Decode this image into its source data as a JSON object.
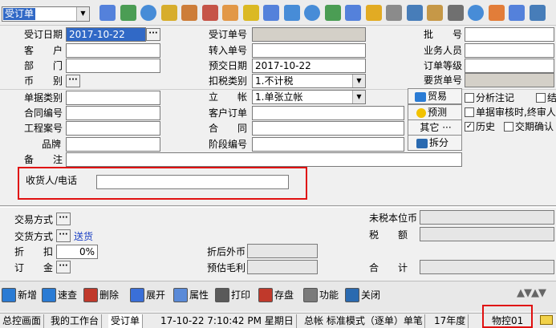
{
  "window_select": "受订单",
  "toolbar_icons": [
    "barcode-icon",
    "monitor-icon",
    "globe-icon",
    "lock-icon",
    "briefcase-icon",
    "house-icon",
    "users-icon",
    "mail-icon",
    "book-icon",
    "key-icon",
    "help-icon",
    "dollar-icon",
    "cart-icon",
    "finance-icon",
    "copy-icon",
    "calc-icon",
    "db-icon",
    "print-icon",
    "check-icon",
    "flag-icon",
    "search-doc-icon",
    "zoom-icon"
  ],
  "form": {
    "order_date_label": "受订日期",
    "order_date": "2017-10-22",
    "customer_label": "客　　户",
    "department_label": "部　　门",
    "currency_label": "币　　别",
    "doc_type_label": "单据类别",
    "contract_no_label": "合同编号",
    "project_no_label": "工程案号",
    "brand_label": "品牌",
    "remark_label": "备　　注",
    "order_no_label": "受订单号",
    "import_no_label": "转入单号",
    "delivery_date_label": "预交日期",
    "delivery_date": "2017-10-22",
    "tax_type_label": "扣税类别",
    "tax_type": "1.不计税",
    "account_label": "立　　帐",
    "account": "1.单张立帐",
    "cust_order_label": "客户订单",
    "contract_label": "合　　同",
    "stage_no_label": "阶段编号",
    "batch_label": "批　　号",
    "salesman_label": "业务人员",
    "order_level_label": "订单等级",
    "req_no_label": "要货单号",
    "receiver_label": "收货人/电话"
  },
  "side_buttons": {
    "trade": "贸易",
    "forecast": "预测",
    "other": "其它",
    "split": "拆分"
  },
  "checkboxes": {
    "analysis": "分析注记",
    "settle": "结",
    "audit": "单据审核时,终审人",
    "history": "历史",
    "history_checked": true,
    "delivery_confirm": "交期确认"
  },
  "lower": {
    "trade_method_label": "交易方式",
    "delivery_method_label": "交货方式",
    "delivery_method": "送货",
    "discount_label": "折　　扣",
    "discount_value": "0%",
    "deposit_label": "订　　金",
    "after_discount_label": "折后外币",
    "est_profit_label": "预估毛利",
    "untaxed_label": "未税本位币",
    "tax_label": "税　　额",
    "total_label": "合　　计"
  },
  "bottom_buttons": [
    "新增",
    "速查",
    "删除",
    "展开",
    "属性",
    "打印",
    "存盘",
    "功能",
    "关闭"
  ],
  "statusbar": {
    "tab1": "总控画面",
    "tab2": "我的工作台",
    "tab3": "受订单",
    "datetime": "17-10-22 7:10:42 PM 星期日",
    "mode": "总帐 标准模式（逐单）单笔",
    "year": "17年度",
    "control": "物控01"
  },
  "colors": {
    "accent_blue": "#3169c6",
    "highlight_red": "#e01010",
    "gray_field": "#d4d0c8"
  }
}
